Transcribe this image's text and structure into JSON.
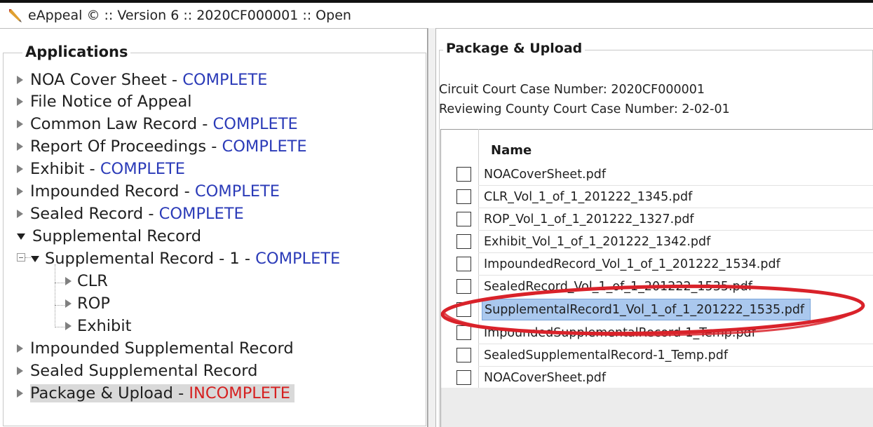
{
  "window": {
    "title": "eAppeal © :: Version 6 :: 2020CF000001 :: Open",
    "icon": "pencil-icon"
  },
  "applications": {
    "legend": "Applications",
    "items": [
      {
        "label": "NOA Cover Sheet",
        "status": "COMPLETE",
        "expander": "collapsed"
      },
      {
        "label": "File Notice of Appeal",
        "status": "",
        "expander": "collapsed"
      },
      {
        "label": "Common Law Record",
        "status": "COMPLETE",
        "expander": "collapsed"
      },
      {
        "label": "Report Of Proceedings",
        "status": "COMPLETE",
        "expander": "collapsed"
      },
      {
        "label": "Exhibit",
        "status": "COMPLETE",
        "expander": "collapsed"
      },
      {
        "label": "Impounded Record",
        "status": "COMPLETE",
        "expander": "collapsed"
      },
      {
        "label": "Sealed Record",
        "status": "COMPLETE",
        "expander": "collapsed"
      },
      {
        "label": "Supplemental Record",
        "status": "",
        "expander": "expanded"
      },
      {
        "label": "Supplemental Record - 1",
        "status": "COMPLETE",
        "expander": "expanded"
      },
      {
        "label": "CLR",
        "status": "",
        "expander": "collapsed"
      },
      {
        "label": "ROP",
        "status": "",
        "expander": "collapsed"
      },
      {
        "label": "Exhibit",
        "status": "",
        "expander": "collapsed"
      },
      {
        "label": "Impounded Supplemental Record",
        "status": "",
        "expander": "collapsed"
      },
      {
        "label": "Sealed Supplemental Record",
        "status": "",
        "expander": "collapsed"
      },
      {
        "label": "Package & Upload",
        "status": "INCOMPLETE",
        "expander": "collapsed",
        "selected": true
      }
    ],
    "separator": " - "
  },
  "package": {
    "legend": "Package & Upload",
    "circuit_case": "Circuit Court Case Number: 2020CF000001",
    "reviewing_case": "Reviewing County Court Case Number: 2-02-01",
    "table": {
      "header": "Name",
      "rows": [
        {
          "name": "NOACoverSheet.pdf",
          "checked": false
        },
        {
          "name": "CLR_Vol_1_of_1_201222_1345.pdf",
          "checked": false
        },
        {
          "name": "ROP_Vol_1_of_1_201222_1327.pdf",
          "checked": false
        },
        {
          "name": "Exhibit_Vol_1_of_1_201222_1342.pdf",
          "checked": false
        },
        {
          "name": "ImpoundedRecord_Vol_1_of_1_201222_1534.pdf",
          "checked": false
        },
        {
          "name": "SealedRecord_Vol_1_of_1_201222_1535.pdf",
          "checked": false
        },
        {
          "name": "SupplementalRecord1_Vol_1_of_1_201222_1535.pdf",
          "checked": false,
          "selected": true
        },
        {
          "name": "ImpoundedSupplementalRecord-1_Temp.pdf",
          "checked": false
        },
        {
          "name": "SealedSupplementalRecord-1_Temp.pdf",
          "checked": false
        },
        {
          "name": "NOACoverSheet.pdf",
          "checked": false
        }
      ]
    }
  },
  "colors": {
    "complete": "#2b3bb8",
    "incomplete": "#d62020",
    "selection": "#aac8ee",
    "annotation": "#d9222a"
  }
}
